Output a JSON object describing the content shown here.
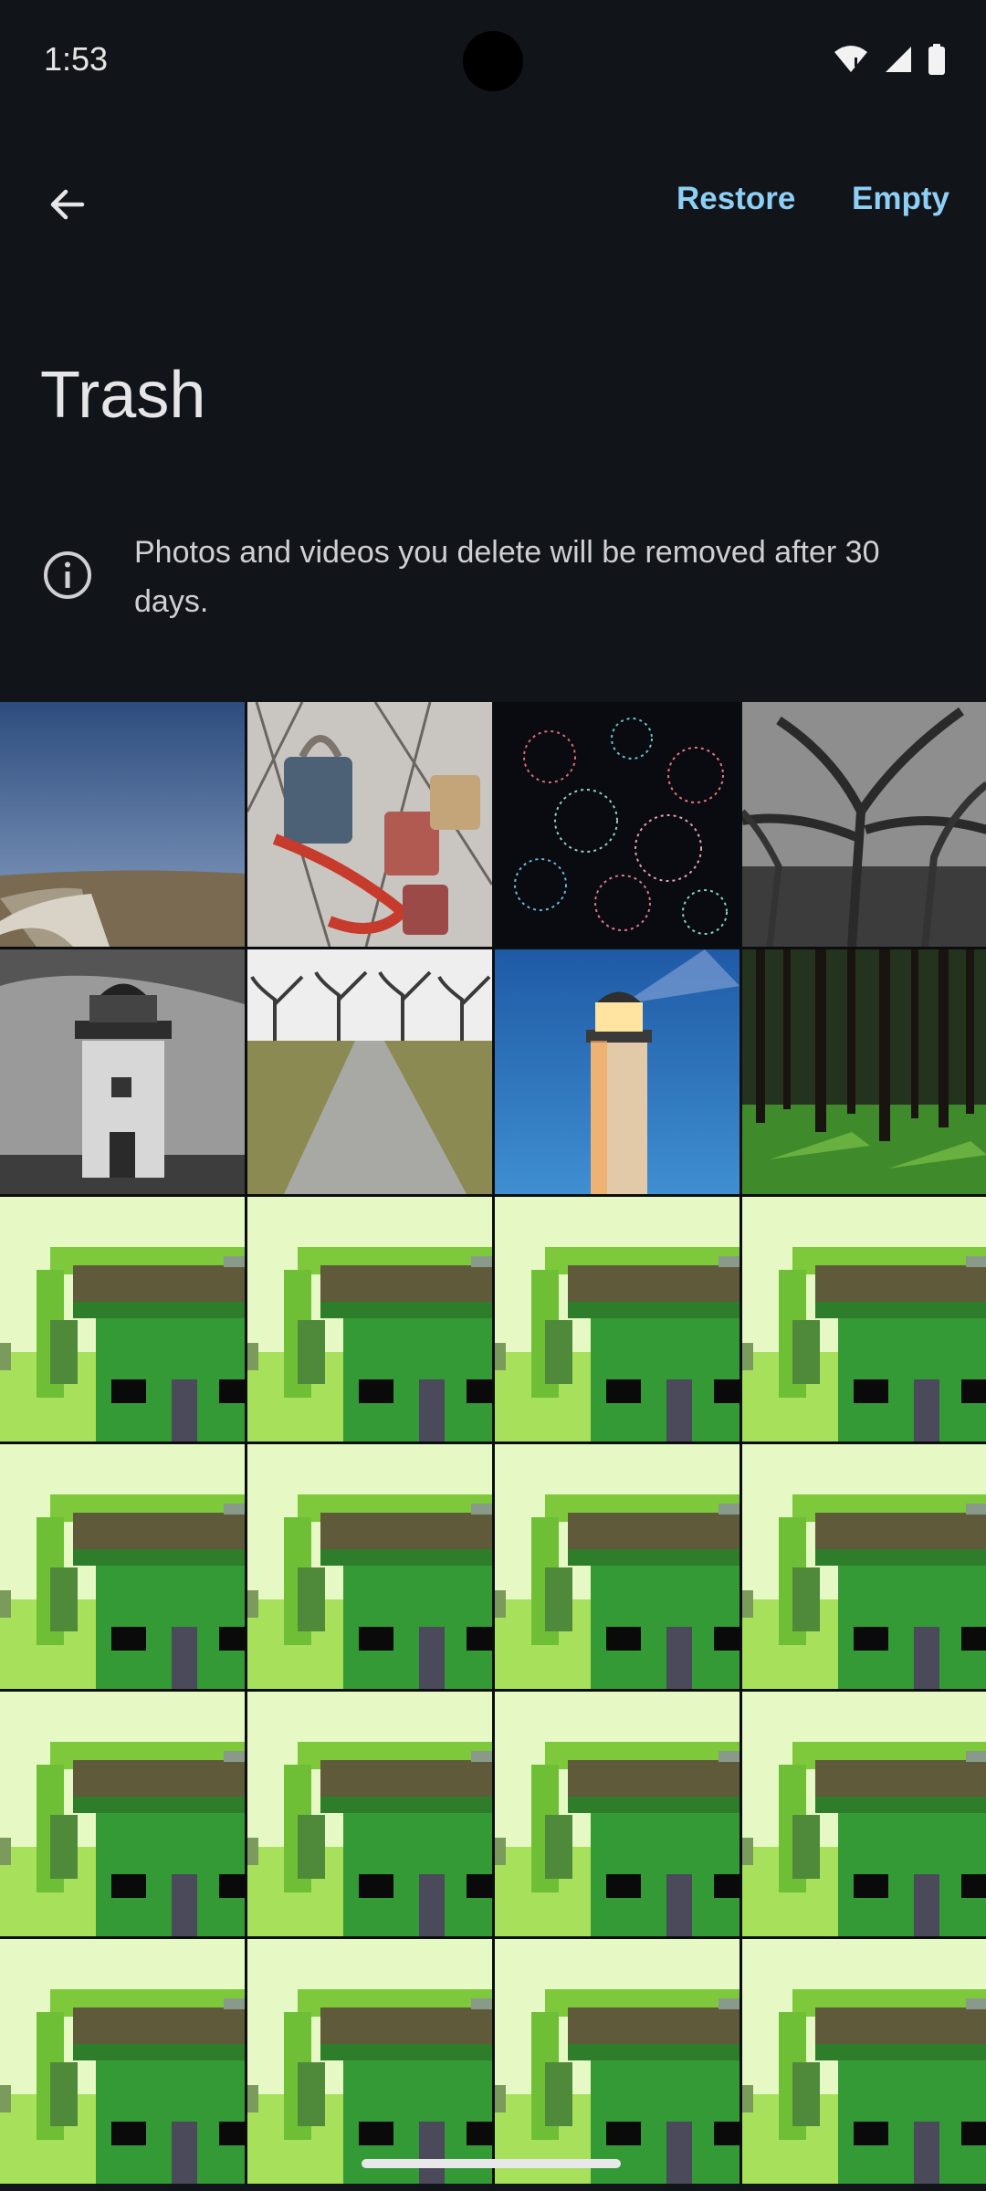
{
  "status_bar": {
    "time": "1:53",
    "icons": [
      "wifi-icon",
      "signal-icon",
      "battery-icon"
    ]
  },
  "top_bar": {
    "back_icon": "arrow-left-icon",
    "restore_label": "Restore",
    "empty_label": "Empty"
  },
  "page": {
    "title": "Trash"
  },
  "info": {
    "icon": "info-icon",
    "text": "Photos and videos you delete will be removed after 30 days."
  },
  "colors": {
    "background": "#111418",
    "accent": "#8ecff6",
    "text": "#e3e3e6"
  },
  "grid": {
    "photos": [
      "field-path",
      "padlocks",
      "fireworks",
      "bw-trees",
      "bw-lighthouse",
      "tree-path",
      "lighthouse-night",
      "forest"
    ],
    "placeholder_count": 16,
    "placeholder_name": "pixel-house-thumbnail"
  }
}
